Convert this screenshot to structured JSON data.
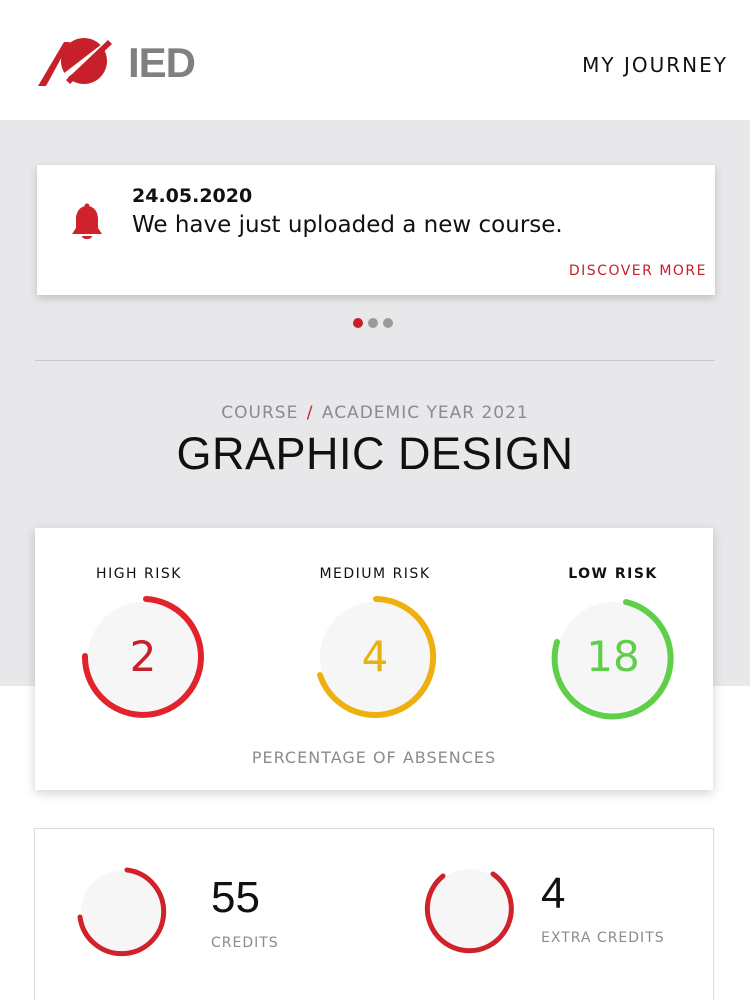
{
  "header": {
    "logo_text": "IED",
    "nav_label": "MY JOURNEY",
    "brand_color": "#c8202b"
  },
  "notification": {
    "icon": "bell-icon",
    "date": "24.05.2020",
    "message": "We have just uploaded a new course.",
    "link_label": "DISCOVER MORE"
  },
  "carousel": {
    "total": 3,
    "active_index": 0
  },
  "course": {
    "prefix": "COURSE",
    "separator": "/",
    "year_label": "ACADEMIC YEAR 2021",
    "title": "GRAPHIC DESIGN"
  },
  "risks": {
    "items": [
      {
        "label": "HIGH RISK",
        "value": "2",
        "color": "#e1232b",
        "gradient_end": "#d11a22"
      },
      {
        "label": "MEDIUM RISK",
        "value": "4",
        "color": "#e8b10e",
        "gradient_end": "#f0a21a"
      },
      {
        "label": "LOW RISK",
        "value": "18",
        "color": "#5fcf4a",
        "gradient_end": "#4cc83e"
      }
    ],
    "footer": "PERCENTAGE OF ABSENCES"
  },
  "credits": {
    "items": [
      {
        "value": "55",
        "label": "CREDITS",
        "color": "#d0222a"
      },
      {
        "value": "4",
        "label": "EXTRA CREDITS",
        "color": "#d0222a"
      }
    ]
  }
}
